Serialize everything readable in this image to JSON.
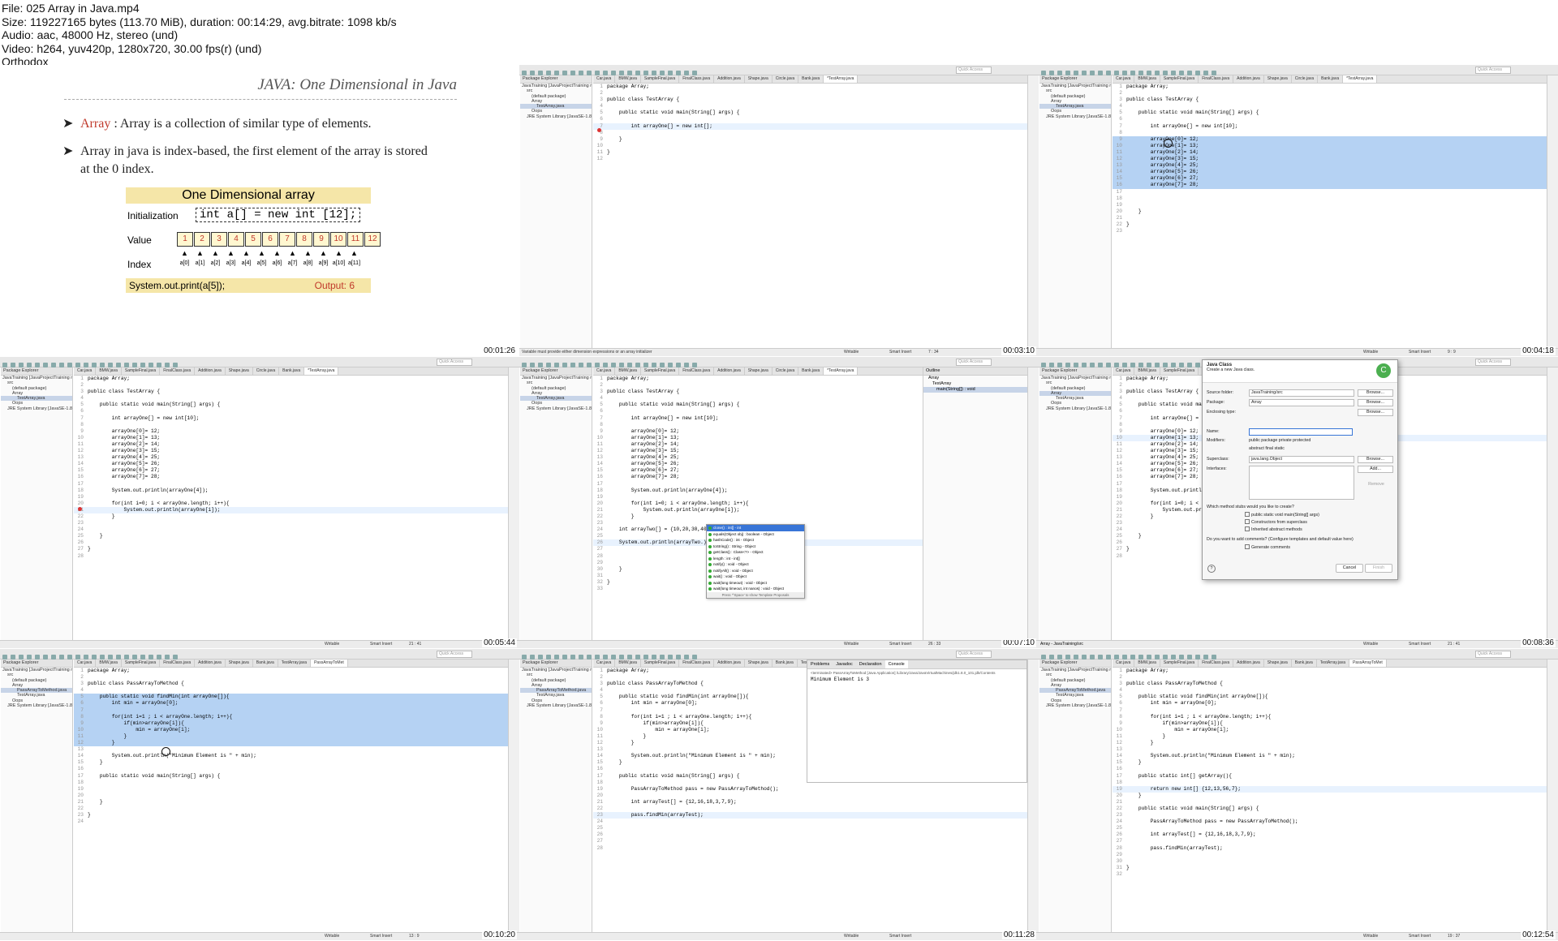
{
  "header": {
    "lines": [
      "File: 025 Array in Java.mp4",
      "Size: 119227165 bytes (113.70 MiB), duration: 00:14:29, avg.bitrate: 1098 kb/s",
      "Audio: aac, 48000 Hz, stereo (und)",
      "Video: h264, yuv420p, 1280x720, 30.00 fps(r) (und)",
      "Orthodox"
    ]
  },
  "timestamps": [
    "00:01:26",
    "00:03:10",
    "00:04:18",
    "00:05:44",
    "00:07:10",
    "00:08:36",
    "00:10:20",
    "00:11:28",
    "00:12:54"
  ],
  "slide": {
    "title": "JAVA: One Dimensional in Java",
    "bullet1_kw": "Array",
    "bullet1_rest": " : Array is a collection of similar type of elements.",
    "bullet2": "Array in java is index-based, the first element of the array is stored at the 0 index.",
    "diagram_title": "One Dimensional array",
    "init_label": "Initialization",
    "init_code": "int a[] = new int [12];",
    "value_label": "Value",
    "values": [
      "1",
      "2",
      "3",
      "4",
      "5",
      "6",
      "7",
      "8",
      "9",
      "10",
      "11",
      "12"
    ],
    "index_label": "Index",
    "indices": [
      "a[0]",
      "a[1]",
      "a[2]",
      "a[3]",
      "a[4]",
      "a[5]",
      "a[6]",
      "a[7]",
      "a[8]",
      "a[9]",
      "a[10]",
      "a[11]"
    ],
    "print_code": "System.out.print(a[5]);",
    "output": "Output: 6"
  },
  "eclipse": {
    "quick_access": "Quick Access",
    "package_explorer": "Package Explorer",
    "tree": [
      "JavaTraining [JavaProjectTraining m]",
      "src",
      "(default package)",
      "Array",
      "TestArray.java",
      "Oops",
      "JRE System Library [JavaSE-1.8]"
    ],
    "tree_pass": [
      "JavaTraining [JavaProjectTraining m]",
      "src",
      "(default package)",
      "Array",
      "PassArrayToMethod.java",
      "TestArray.java",
      "Oops",
      "JRE System Library [JavaSE-1.8]"
    ],
    "tabs": [
      "Car.java",
      "BMW.java",
      "SampleFinal.java",
      "FinalClass.java",
      "Addition.java",
      "Shape.java",
      "Circle.java",
      "Bank.java",
      "*TestArray.java"
    ],
    "tabs_pass": [
      "Car.java",
      "BMW.java",
      "SampleFinal.java",
      "FinalClass.java",
      "Addition.java",
      "Shape.java",
      "Bank.java",
      "TestArray.java",
      "PassArrayToMet"
    ],
    "writable": "Writable",
    "smart_insert": "Smart Insert"
  },
  "tile2": {
    "lines": [
      "package Array;",
      "",
      "public class TestArray {",
      "",
      "    public static void main(String[] args) {",
      "",
      "        int arrayOne[] = new int[];",
      "",
      "    }",
      "",
      "}",
      ""
    ],
    "status_error": "Variable must provide either dimension expressions or an array initializer",
    "position": "7 : 34"
  },
  "tile3": {
    "lines": [
      "package Array;",
      "",
      "public class TestArray {",
      "",
      "    public static void main(String[] args) {",
      "",
      "        int arrayOne[] = new int[10];",
      "",
      "        arrayOne[0]= 12;",
      "        arrayOne[1]= 13;",
      "        arrayOne[2]= 14;",
      "        arrayOne[3]= 15;",
      "        arrayOne[4]= 25;",
      "        arrayOne[5]= 26;",
      "        arrayOne[6]= 27;",
      "        arrayOne[7]= 28;",
      "",
      "",
      "",
      "    }",
      "",
      "}",
      ""
    ],
    "position": "9 : 9"
  },
  "tile4": {
    "lines": [
      "package Array;",
      "",
      "public class TestArray {",
      "",
      "    public static void main(String[] args) {",
      "",
      "        int arrayOne[] = new int[10];",
      "",
      "        arrayOne[0]= 12;",
      "        arrayOne[1]= 13;",
      "        arrayOne[2]= 14;",
      "        arrayOne[3]= 15;",
      "        arrayOne[4]= 25;",
      "        arrayOne[5]= 26;",
      "        arrayOne[6]= 27;",
      "        arrayOne[7]= 28;",
      "",
      "        System.out.println(arrayOne[4]);",
      "",
      "        for(int i=0; i < arrayOne.length; i++){",
      "            System.out.println(arrayOne[i]);",
      "        }",
      "",
      "",
      "    }",
      "",
      "}",
      ""
    ],
    "position": "21 : 41"
  },
  "tile5": {
    "lines": [
      "package Array;",
      "",
      "public class TestArray {",
      "",
      "    public static void main(String[] args) {",
      "",
      "        int arrayOne[] = new int[10];",
      "",
      "        arrayOne[0]= 12;",
      "        arrayOne[1]= 13;",
      "        arrayOne[2]= 14;",
      "        arrayOne[3]= 15;",
      "        arrayOne[4]= 25;",
      "        arrayOne[5]= 26;",
      "        arrayOne[6]= 27;",
      "        arrayOne[7]= 28;",
      "",
      "        System.out.println(arrayOne[4]);",
      "",
      "        for(int i=0; i < arrayOne.length; i++){",
      "            System.out.println(arrayOne[i]);",
      "        }",
      "",
      "    int arrayTwo[] = {10,20,30,40,50,60};",
      "",
      "    System.out.println(arrayTwo.);",
      "",
      "",
      "",
      "    }",
      "",
      "}",
      ""
    ],
    "outline_tab": "Outline",
    "outline": [
      "Array",
      "TestArray",
      "main(String[]) : void"
    ],
    "assist": [
      "clone() : int[] - int",
      "equals(Object obj) : boolean - Object",
      "hashCode() : int - Object",
      "toString() : String - Object",
      "getClass() : Class<?> - Object",
      "length : int - int[]",
      "notify() : void - Object",
      "notifyAll() : void - Object",
      "wait() : void - Object",
      "wait(long timeout) : void - Object",
      "wait(long timeout, int nanos) : void - Object"
    ],
    "assist_footer": "Press '^Space' to show Template Proposals",
    "position": "26 : 33"
  },
  "tile6": {
    "title": "Java Class",
    "subtitle": "Create a new Java class.",
    "source_folder_label": "Source folder:",
    "source_folder": "JavaTraining/src",
    "package_label": "Package:",
    "package": "Array",
    "enclosing_label": "Enclosing type:",
    "name_label": "Name:",
    "modifiers_label": "Modifiers:",
    "modifiers": "public   package   private   protected",
    "modifiers2": "abstract   final   static",
    "superclass_label": "Superclass:",
    "superclass": "java.lang.Object",
    "interfaces_label": "Interfaces:",
    "browse": "Browse...",
    "add": "Add...",
    "remove": "Remove",
    "stubs_q": "Which method stubs would you like to create?",
    "stub1": "public static void main(String[] args)",
    "stub2": "Constructors from superclass",
    "stub3": "Inherited abstract methods",
    "comments_q": "Do you want to add comments? (Configure templates and default value here)",
    "stub4": "Generate comments",
    "cancel": "Cancel",
    "finish": "Finish",
    "bottom_label": "Array - JavaTraining/src"
  },
  "tile7": {
    "lines": [
      "package Array;",
      "",
      "public class PassArrayToMethod {",
      "",
      "    public static void findMin(int arrayOne[]){",
      "        int min = arrayOne[0];",
      "",
      "        for(int i=1 ; i < arrayOne.length; i++){",
      "            if(min>arrayOne[i]){",
      "                min = arrayOne[i];",
      "            }",
      "        }",
      "",
      "        System.out.println(\"Minimum Element is \" + min);",
      "    }",
      "",
      "    public static void main(String[] args) {",
      "",
      "",
      "",
      "    }",
      "",
      "}",
      ""
    ],
    "position": "13 : 9"
  },
  "tile8": {
    "lines": [
      "package Array;",
      "",
      "public class PassArrayToMethod {",
      "",
      "    public static void findMin(int arrayOne[]){",
      "        int min = arrayOne[0];",
      "",
      "        for(int i=1 ; i < arrayOne.length; i++){",
      "            if(min>arrayOne[i]){",
      "                min = arrayOne[i];",
      "            }",
      "        }",
      "",
      "        System.out.println(\"Minimum Element is \" + min);",
      "    }",
      "",
      "    public static void main(String[] args) {",
      "",
      "        PassArrayToMethod pass = new PassArrayToMethod();",
      "",
      "        int arrayTest[] = {12,16,18,3,7,9};",
      "",
      "        pass.findMin(arrayTest);",
      "",
      "",
      "",
      "",
      ""
    ],
    "console_tabs": [
      "Problems",
      "Javadoc",
      "Declaration",
      "Console"
    ],
    "console_term": "<terminated> PassArrayToMethod [Java Application] /Library/Java/JavaVirtualMachines/jdk1.8.0_101.jdk/Contents",
    "console_out": "Minimum Element is 3"
  },
  "tile9": {
    "lines": [
      "package Array;",
      "",
      "public class PassArrayToMethod {",
      "",
      "    public static void findMin(int arrayOne[]){",
      "        int min = arrayOne[0];",
      "",
      "        for(int i=1 ; i < arrayOne.length; i++){",
      "            if(min>arrayOne[i]){",
      "                min = arrayOne[i];",
      "            }",
      "        }",
      "",
      "        System.out.println(\"Minimum Element is \" + min);",
      "    }",
      "",
      "    public static int[] getArray(){",
      "",
      "        return new int[] {12,13,56,7};",
      "    }",
      "",
      "    public static void main(String[] args) {",
      "",
      "        PassArrayToMethod pass = new PassArrayToMethod();",
      "",
      "        int arrayTest[] = {12,16,18,3,7,9};",
      "",
      "        pass.findMin(arrayTest);",
      "",
      "",
      "}",
      ""
    ],
    "position": "19 : 37"
  }
}
